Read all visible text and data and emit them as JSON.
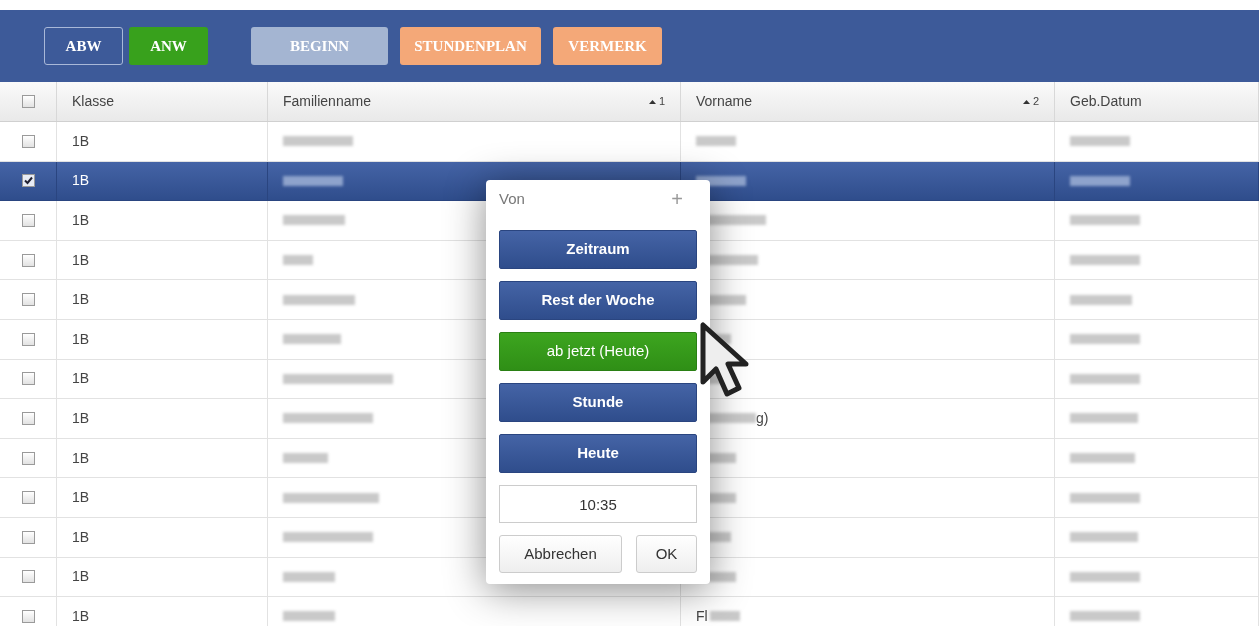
{
  "toolbar": [
    {
      "label": "ABW",
      "kind": "outline"
    },
    {
      "label": "ANW",
      "kind": "green"
    },
    {
      "label": "BEGINN",
      "kind": "muted"
    },
    {
      "label": "STUNDENPLAN",
      "kind": "orange"
    },
    {
      "label": "VERMERK",
      "kind": "orange"
    }
  ],
  "table": {
    "columns": [
      {
        "label": "Klasse"
      },
      {
        "label": "Familienname",
        "sort": "1"
      },
      {
        "label": "Vorname",
        "sort": "2"
      },
      {
        "label": "Geb.Datum"
      }
    ],
    "header_checked": false,
    "rows": [
      {
        "klasse": "1B",
        "selected": false
      },
      {
        "klasse": "1B",
        "selected": true
      },
      {
        "klasse": "1B",
        "selected": false
      },
      {
        "klasse": "1B",
        "selected": false
      },
      {
        "klasse": "1B",
        "selected": false
      },
      {
        "klasse": "1B",
        "selected": false
      },
      {
        "klasse": "1B",
        "selected": false
      },
      {
        "klasse": "1B",
        "selected": false,
        "vorname_partial": "g)"
      },
      {
        "klasse": "1B",
        "selected": false
      },
      {
        "klasse": "1B",
        "selected": false
      },
      {
        "klasse": "1B",
        "selected": false
      },
      {
        "klasse": "1B",
        "selected": false
      },
      {
        "klasse": "1B",
        "selected": false,
        "vorname_partial": "Fl"
      }
    ]
  },
  "popup": {
    "title": "Von",
    "add": "+",
    "buttons": [
      {
        "label": "Zeitraum",
        "kind": "primary"
      },
      {
        "label": "Rest der Woche",
        "kind": "primary"
      },
      {
        "label": "ab jetzt (Heute)",
        "kind": "success"
      },
      {
        "label": "Stunde",
        "kind": "primary"
      },
      {
        "label": "Heute",
        "kind": "primary"
      }
    ],
    "time": "10:35",
    "cancel": "Abbrechen",
    "ok": "OK"
  }
}
